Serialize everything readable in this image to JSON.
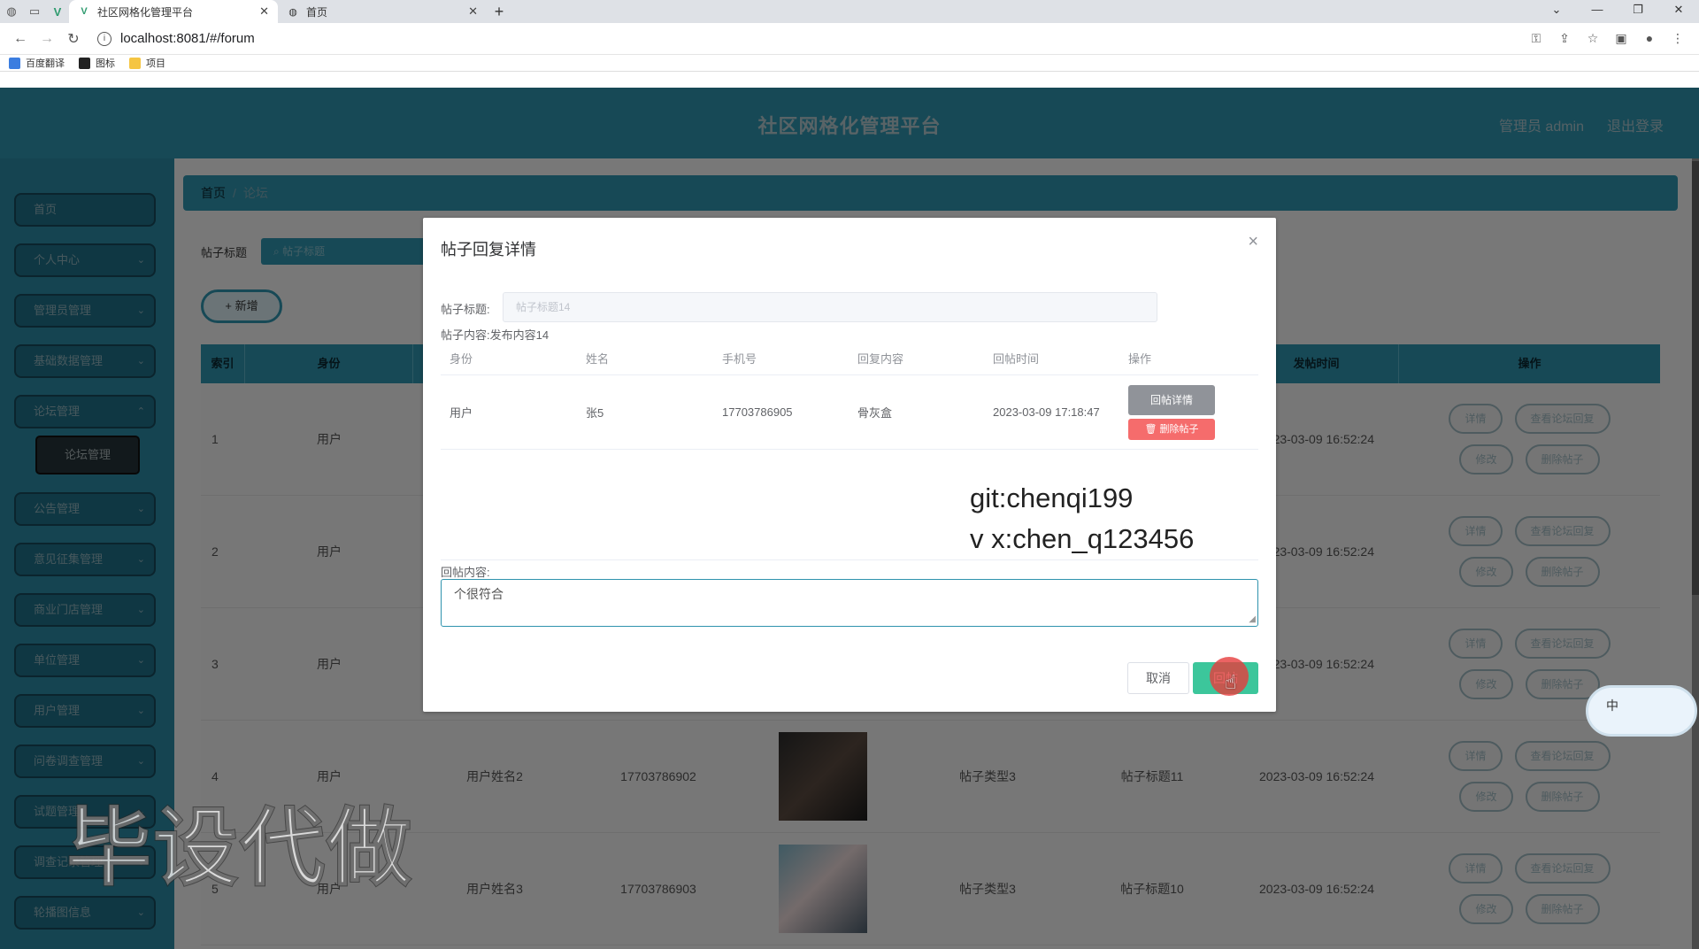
{
  "browser": {
    "tabs": [
      {
        "title": "社区网格化管理平台",
        "active": true
      },
      {
        "title": "首页",
        "active": false
      }
    ],
    "url": "localhost:8081/#/forum",
    "bookmarks": [
      "百度翻译",
      "图标",
      "项目"
    ]
  },
  "header": {
    "title": "社区网格化管理平台",
    "user": "管理员 admin",
    "logout": "退出登录"
  },
  "sidebar": {
    "items": [
      "首页",
      "个人中心",
      "管理员管理",
      "基础数据管理",
      "论坛管理",
      "公告管理",
      "意见征集管理",
      "商业门店管理",
      "单位管理",
      "用户管理",
      "问卷调查管理",
      "试题管理",
      "调查记录管理",
      "轮播图信息"
    ],
    "sub_item": "论坛管理"
  },
  "breadcrumb": {
    "home": "首页",
    "current": "论坛"
  },
  "search": {
    "label": "帖子标题",
    "placeholder": "帖子标题"
  },
  "add_button": "+ 新增",
  "table": {
    "headers": [
      "索引",
      "身份",
      "",
      "",
      "",
      "",
      "",
      "发帖时间",
      "操作"
    ],
    "rows": [
      {
        "index": "1",
        "role": "用户",
        "name": "",
        "phone": "",
        "type": "",
        "title": "",
        "time": "2023-03-09 16:52:24"
      },
      {
        "index": "2",
        "role": "用户",
        "name": "",
        "phone": "",
        "type": "",
        "title": "",
        "time": "2023-03-09 16:52:24"
      },
      {
        "index": "3",
        "role": "用户",
        "name": "",
        "phone": "",
        "type": "",
        "title": "",
        "time": "2023-03-09 16:52:24"
      },
      {
        "index": "4",
        "role": "用户",
        "name": "用户姓名2",
        "phone": "17703786902",
        "type": "帖子类型3",
        "title": "帖子标题11",
        "time": "2023-03-09 16:52:24"
      },
      {
        "index": "5",
        "role": "用户",
        "name": "用户姓名3",
        "phone": "17703786903",
        "type": "帖子类型3",
        "title": "帖子标题10",
        "time": "2023-03-09 16:52:24"
      }
    ],
    "ops": {
      "detail": "详情",
      "view_reply": "查看论坛回复",
      "edit": "修改",
      "delete": "删除帖子"
    }
  },
  "dialog": {
    "title": "帖子回复详情",
    "post_title_label": "帖子标题:",
    "post_title_value": "帖子标题14",
    "post_content_label": "帖子内容:",
    "post_content_value": "发布内容14",
    "headers": [
      "身份",
      "姓名",
      "手机号",
      "回复内容",
      "回帖时间",
      "操作"
    ],
    "row": {
      "role": "用户",
      "name": "张5",
      "phone": "17703786905",
      "content": "骨灰盒",
      "time": "2023-03-09 17:18:47"
    },
    "detail_button": "回帖详情",
    "delete_button": "删除帖子",
    "reply_label": "回帖内容:",
    "reply_value": "个很符合",
    "cancel": "取消",
    "submit": "回帖"
  },
  "overlay_text": {
    "git": "git:chenqi199",
    "vx": "v x:chen_q123456",
    "watermark": "毕设代做"
  },
  "ime": {
    "label": "中"
  }
}
